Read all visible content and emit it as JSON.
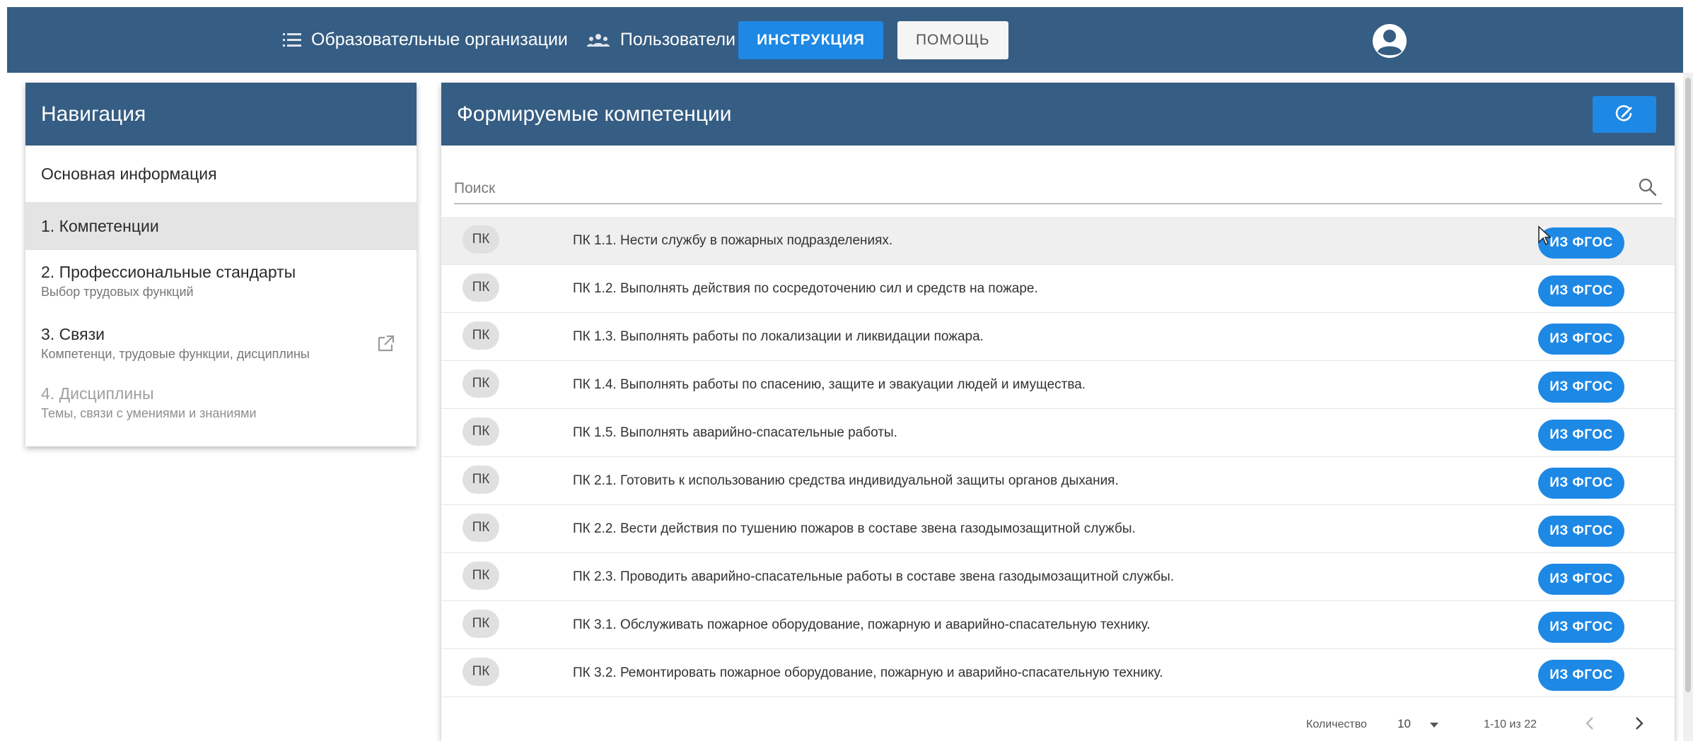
{
  "topbar": {
    "orgs_label": "Образовательные организации",
    "users_label": "Пользователи",
    "instruction_label": "ИНСТРУКЦИЯ",
    "help_label": "ПОМОЩЬ",
    "orgs_icon": "list-icon",
    "users_icon": "group-icon",
    "avatar_icon": "account-circle-icon"
  },
  "colors": {
    "header": "#365d83",
    "accent": "#1e88e5",
    "chip": "#e0e0e0"
  },
  "sidebar": {
    "title": "Навигация",
    "items": [
      {
        "label": "Основная информация",
        "sub": ""
      },
      {
        "label": "1. Компетенции",
        "sub": ""
      },
      {
        "label": "2. Профессиональные стандарты",
        "sub": "Выбор трудовых функций"
      },
      {
        "label": "3. Связи",
        "sub": "Компетенци, трудовые функции, дисциплины"
      },
      {
        "label": "4. Дисциплины",
        "sub": "Темы, связи с умениями и знаниями"
      }
    ]
  },
  "main": {
    "title": "Формируемые компетенции",
    "search_placeholder": "Поиск",
    "rows": [
      {
        "chip": "ПК",
        "text": "ПК 1.1. Нести службу в пожарных подразделениях.",
        "button": "ИЗ ФГОС"
      },
      {
        "chip": "ПК",
        "text": "ПК 1.2. Выполнять действия по сосредоточению сил и средств на пожаре.",
        "button": "ИЗ ФГОС"
      },
      {
        "chip": "ПК",
        "text": "ПК 1.3. Выполнять работы по локализации и ликвидации пожара.",
        "button": "ИЗ ФГОС"
      },
      {
        "chip": "ПК",
        "text": "ПК 1.4. Выполнять работы по спасению, защите и эвакуации людей и имущества.",
        "button": "ИЗ ФГОС"
      },
      {
        "chip": "ПК",
        "text": "ПК 1.5. Выполнять аварийно-спасательные работы.",
        "button": "ИЗ ФГОС"
      },
      {
        "chip": "ПК",
        "text": "ПК 2.1. Готовить к использованию средства индивидуальной защиты органов дыхания.",
        "button": "ИЗ ФГОС"
      },
      {
        "chip": "ПК",
        "text": "ПК 2.2. Вести действия по тушению пожаров в составе звена газодымозащитной службы.",
        "button": "ИЗ ФГОС"
      },
      {
        "chip": "ПК",
        "text": "ПК 2.3. Проводить аварийно-спасательные работы в составе звена газодымозащитной службы.",
        "button": "ИЗ ФГОС"
      },
      {
        "chip": "ПК",
        "text": "ПК 3.1. Обслуживать пожарное оборудование, пожарную и аварийно-спасательную технику.",
        "button": "ИЗ ФГОС"
      },
      {
        "chip": "ПК",
        "text": "ПК 3.2. Ремонтировать пожарное оборудование, пожарную и аварийно-спасательную технику.",
        "button": "ИЗ ФГОС"
      }
    ],
    "pagination": {
      "per_page_label": "Количество",
      "per_page_value": "10",
      "range": "1-10 из 22"
    }
  }
}
